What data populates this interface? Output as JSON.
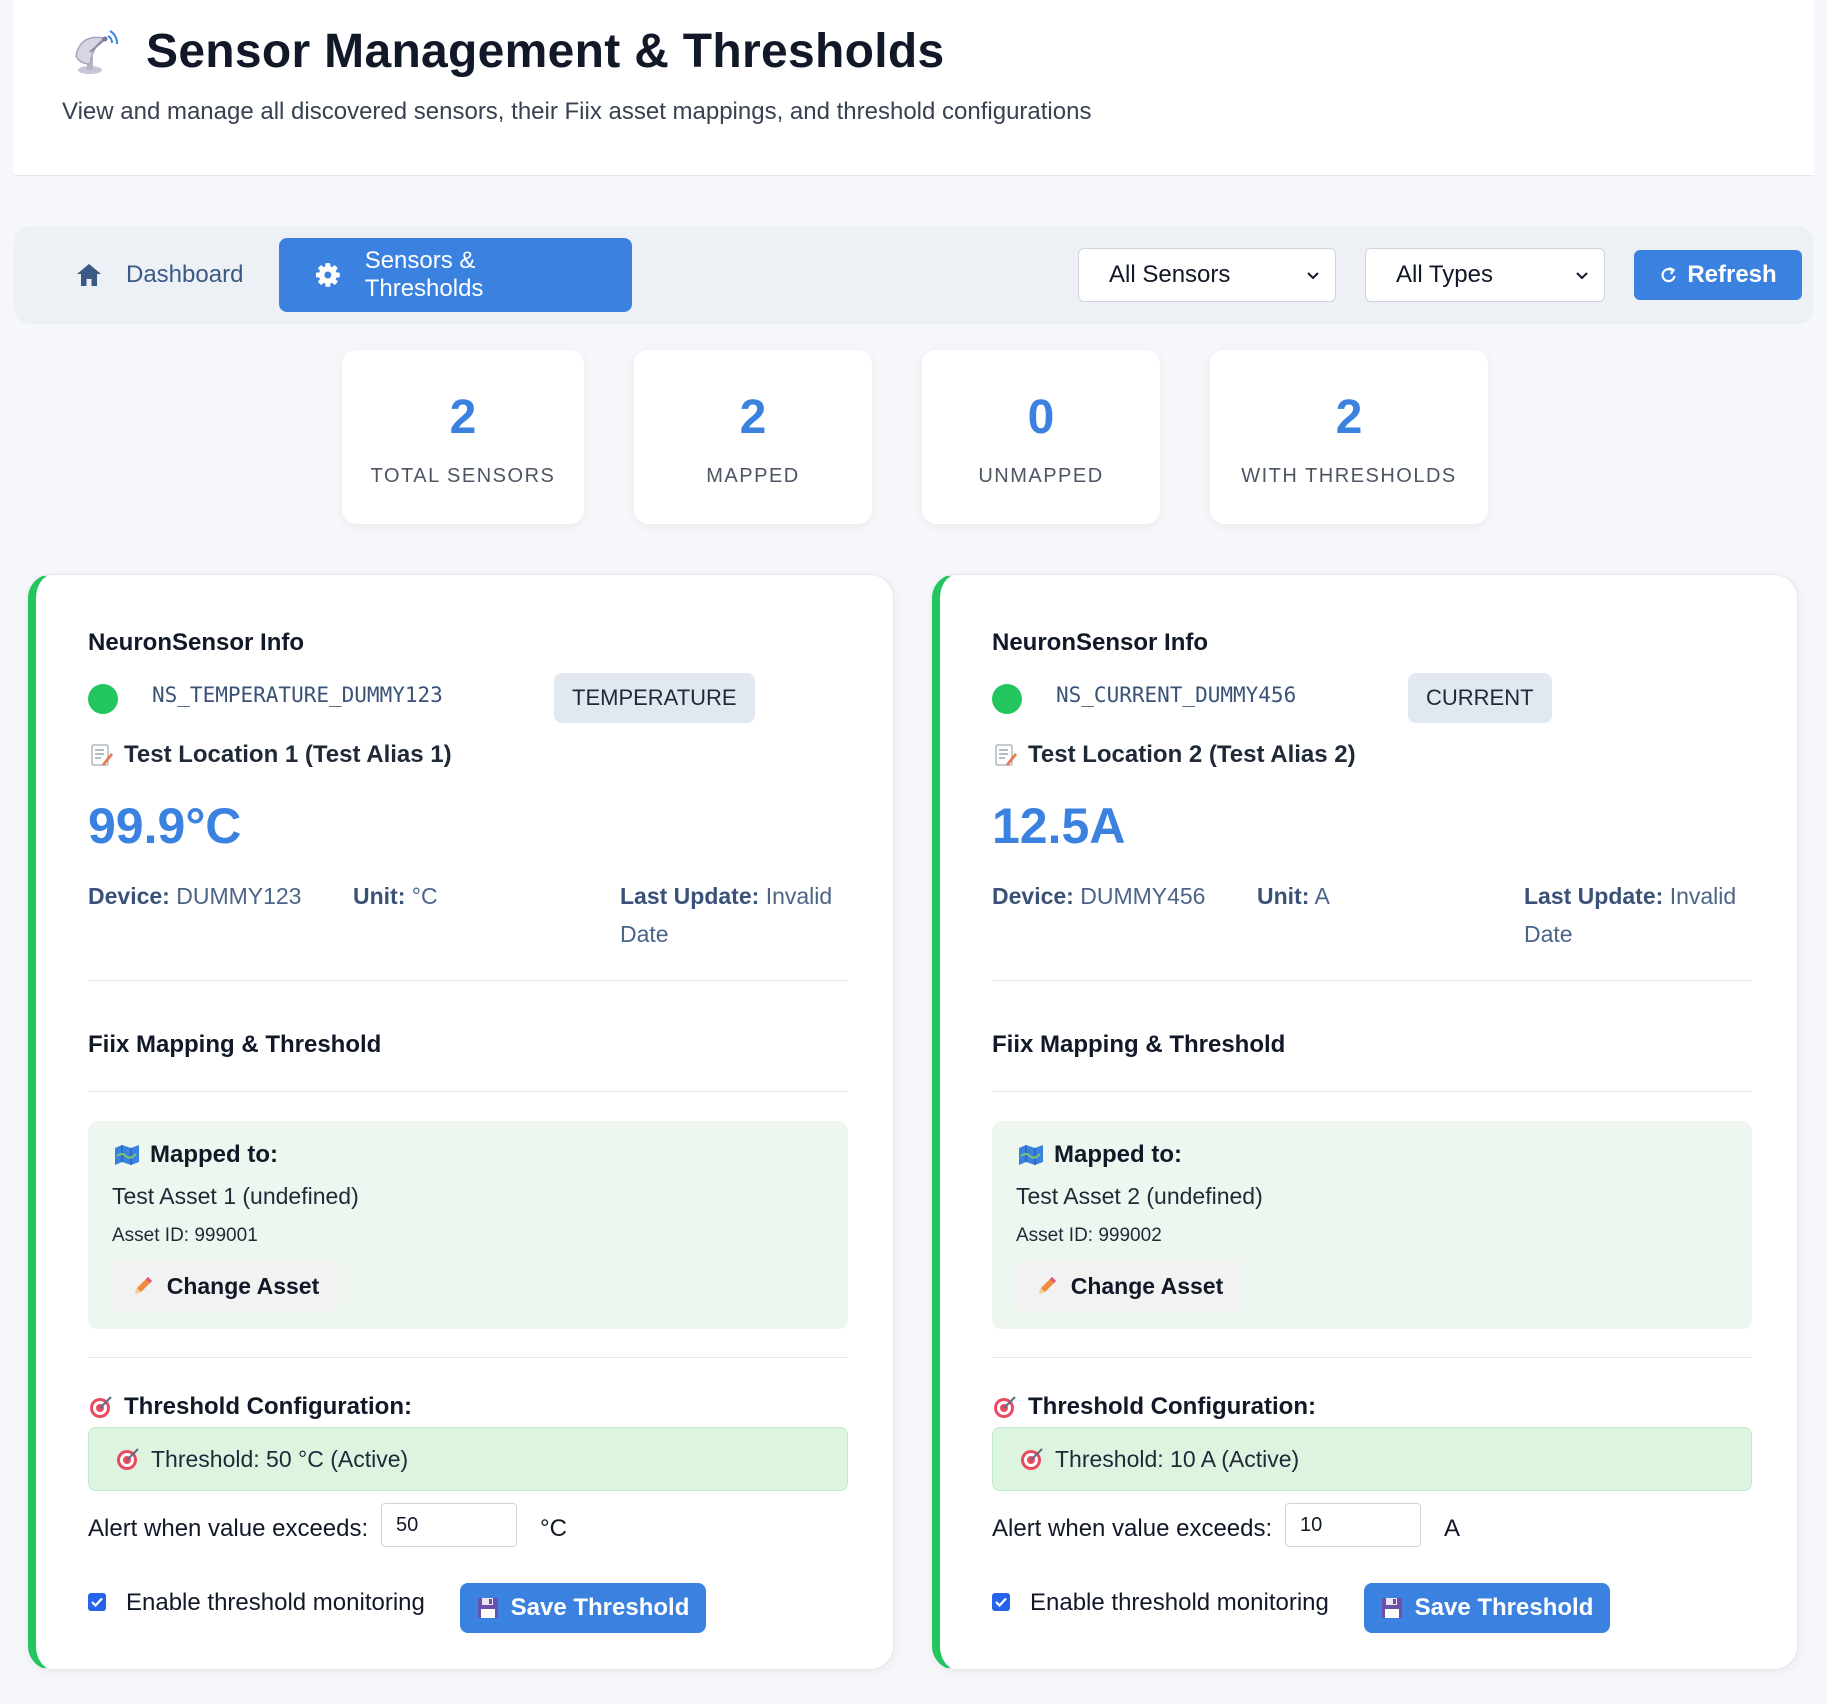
{
  "header": {
    "title": "Sensor Management & Thresholds",
    "subtitle": "View and manage all discovered sensors, their Fiix asset mappings, and threshold configurations",
    "icon": "satellite-antenna-icon"
  },
  "nav": {
    "dashboard_label": "Dashboard",
    "sensors_label": "Sensors & Thresholds",
    "filter_sensors_selected": "All Sensors",
    "filter_types_selected": "All Types",
    "refresh_label": "Refresh"
  },
  "stats": [
    {
      "value": "2",
      "label": "TOTAL SENSORS"
    },
    {
      "value": "2",
      "label": "MAPPED"
    },
    {
      "value": "0",
      "label": "UNMAPPED"
    },
    {
      "value": "2",
      "label": "WITH THRESHOLDS"
    }
  ],
  "sensors": [
    {
      "info_title": "NeuronSensor Info",
      "status_color": "#22c55e",
      "sensor_id": "NS_TEMPERATURE_DUMMY123",
      "type": "TEMPERATURE",
      "location": "Test Location 1 (Test Alias 1)",
      "reading": "99.9°C",
      "device_label": "Device:",
      "device": "DUMMY123",
      "unit_label": "Unit:",
      "unit": "°C",
      "last_update_label": "Last Update:",
      "last_update": "Invalid Date",
      "fiix_title": "Fiix Mapping & Threshold",
      "mapped_label": "Mapped to:",
      "asset_name": "Test Asset 1 (undefined)",
      "asset_id": "Asset ID: 999001",
      "change_label": "Change Asset",
      "threshold_title": "Threshold Configuration:",
      "threshold_status": "Threshold: 50 °C (Active)",
      "alert_label": "Alert when value exceeds:",
      "threshold_value": "50",
      "threshold_unit": "°C",
      "monitor_label": "Enable threshold monitoring",
      "monitor_enabled": true,
      "save_label": "Save Threshold"
    },
    {
      "info_title": "NeuronSensor Info",
      "status_color": "#22c55e",
      "sensor_id": "NS_CURRENT_DUMMY456",
      "type": "CURRENT",
      "location": "Test Location 2 (Test Alias 2)",
      "reading": "12.5A",
      "device_label": "Device:",
      "device": "DUMMY456",
      "unit_label": "Unit:",
      "unit": "A",
      "last_update_label": "Last Update:",
      "last_update": "Invalid Date",
      "fiix_title": "Fiix Mapping & Threshold",
      "mapped_label": "Mapped to:",
      "asset_name": "Test Asset 2 (undefined)",
      "asset_id": "Asset ID: 999002",
      "change_label": "Change Asset",
      "threshold_title": "Threshold Configuration:",
      "threshold_status": "Threshold: 10 A (Active)",
      "alert_label": "Alert when value exceeds:",
      "threshold_value": "10",
      "threshold_unit": "A",
      "monitor_label": "Enable threshold monitoring",
      "monitor_enabled": true,
      "save_label": "Save Threshold"
    }
  ],
  "colors": {
    "accent": "#3b82e0",
    "active_green": "#22c55e",
    "mapped_bg": "#eef7ef"
  }
}
